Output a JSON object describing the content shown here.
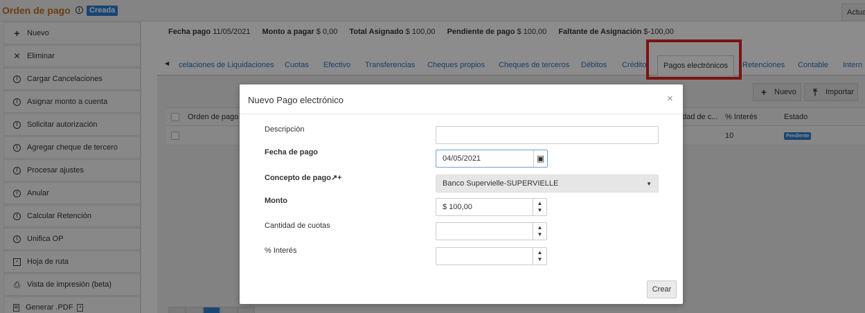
{
  "header": {
    "title": "Orden de pago",
    "status": "Creada",
    "update_label": "Actua"
  },
  "sidebar": {
    "items": [
      {
        "label": "Nuevo",
        "icon": "plus-icon"
      },
      {
        "label": "Eliminar",
        "icon": "x-icon"
      },
      {
        "label": "Cargar Cancelaciones",
        "icon": "exclamation-circle-icon"
      },
      {
        "label": "Asignar monto a cuenta",
        "icon": "exclamation-circle-icon"
      },
      {
        "label": "Solicitar autorización",
        "icon": "exclamation-circle-icon"
      },
      {
        "label": "Agregar cheque de tercero",
        "icon": "exclamation-circle-icon"
      },
      {
        "label": "Procesar ajustes",
        "icon": "exclamation-circle-icon"
      },
      {
        "label": "Anular",
        "icon": "exclamation-circle-icon"
      },
      {
        "label": "Calcular Retención",
        "icon": "exclamation-circle-icon"
      },
      {
        "label": "Unifica OP",
        "icon": "exclamation-circle-icon"
      },
      {
        "label": "Hoja de ruta",
        "icon": "calendar-icon"
      },
      {
        "label": "Vista de impresión (beta)",
        "icon": "printer-icon"
      },
      {
        "label": "Generar .PDF",
        "icon": "pdf-icon"
      }
    ]
  },
  "summary": {
    "fecha_pago_label": "Fecha pago",
    "fecha_pago_value": "11/05/2021",
    "monto_label": "Monto a pagar",
    "monto_value": "$ 0,00",
    "total_label": "Total Asignado",
    "total_value": "$ 100,00",
    "pendiente_label": "Pendiente de pago",
    "pendiente_value": "$ 100,00",
    "faltante_label": "Faltante de Asignación",
    "faltante_value": "$-100,00"
  },
  "tabs": [
    "celaciones de Liquidaciones",
    "Cuotas",
    "Efectivo",
    "Transferencias",
    "Cheques propios",
    "Cheques de terceros",
    "Débitos",
    "Crédito",
    "Pagos electrónicos",
    "Retenciones",
    "Contable",
    "Intern"
  ],
  "toolbar": {
    "new_label": "Nuevo",
    "import_label": "Importar"
  },
  "grid": {
    "columns": [
      "Orden de pago",
      "dad de c...",
      "% Interés",
      "Estado"
    ],
    "rows": [
      {
        "interes": "10",
        "estado": "Pendiente"
      }
    ]
  },
  "modal": {
    "title": "Nuevo Pago electrónico",
    "close": "×",
    "fields": {
      "descripcion_label": "Descripción",
      "descripcion_value": "",
      "fecha_label": "Fecha de pago",
      "fecha_value": "04/05/2021",
      "concepto_label": "Concepto de pago",
      "concepto_value": "Banco Supervielle-SUPERVIELLE",
      "monto_label": "Monto",
      "monto_value": "$ 100,00",
      "cuotas_label": "Cantidad de cuotas",
      "cuotas_value": "",
      "interes_label": "% Interés",
      "interes_value": ""
    },
    "create_label": "Crear"
  },
  "colors": {
    "brand_orange": "#c8731e",
    "badge_blue": "#2f80d6",
    "link_blue": "#2f6fbe",
    "highlight_red": "#e02424"
  }
}
